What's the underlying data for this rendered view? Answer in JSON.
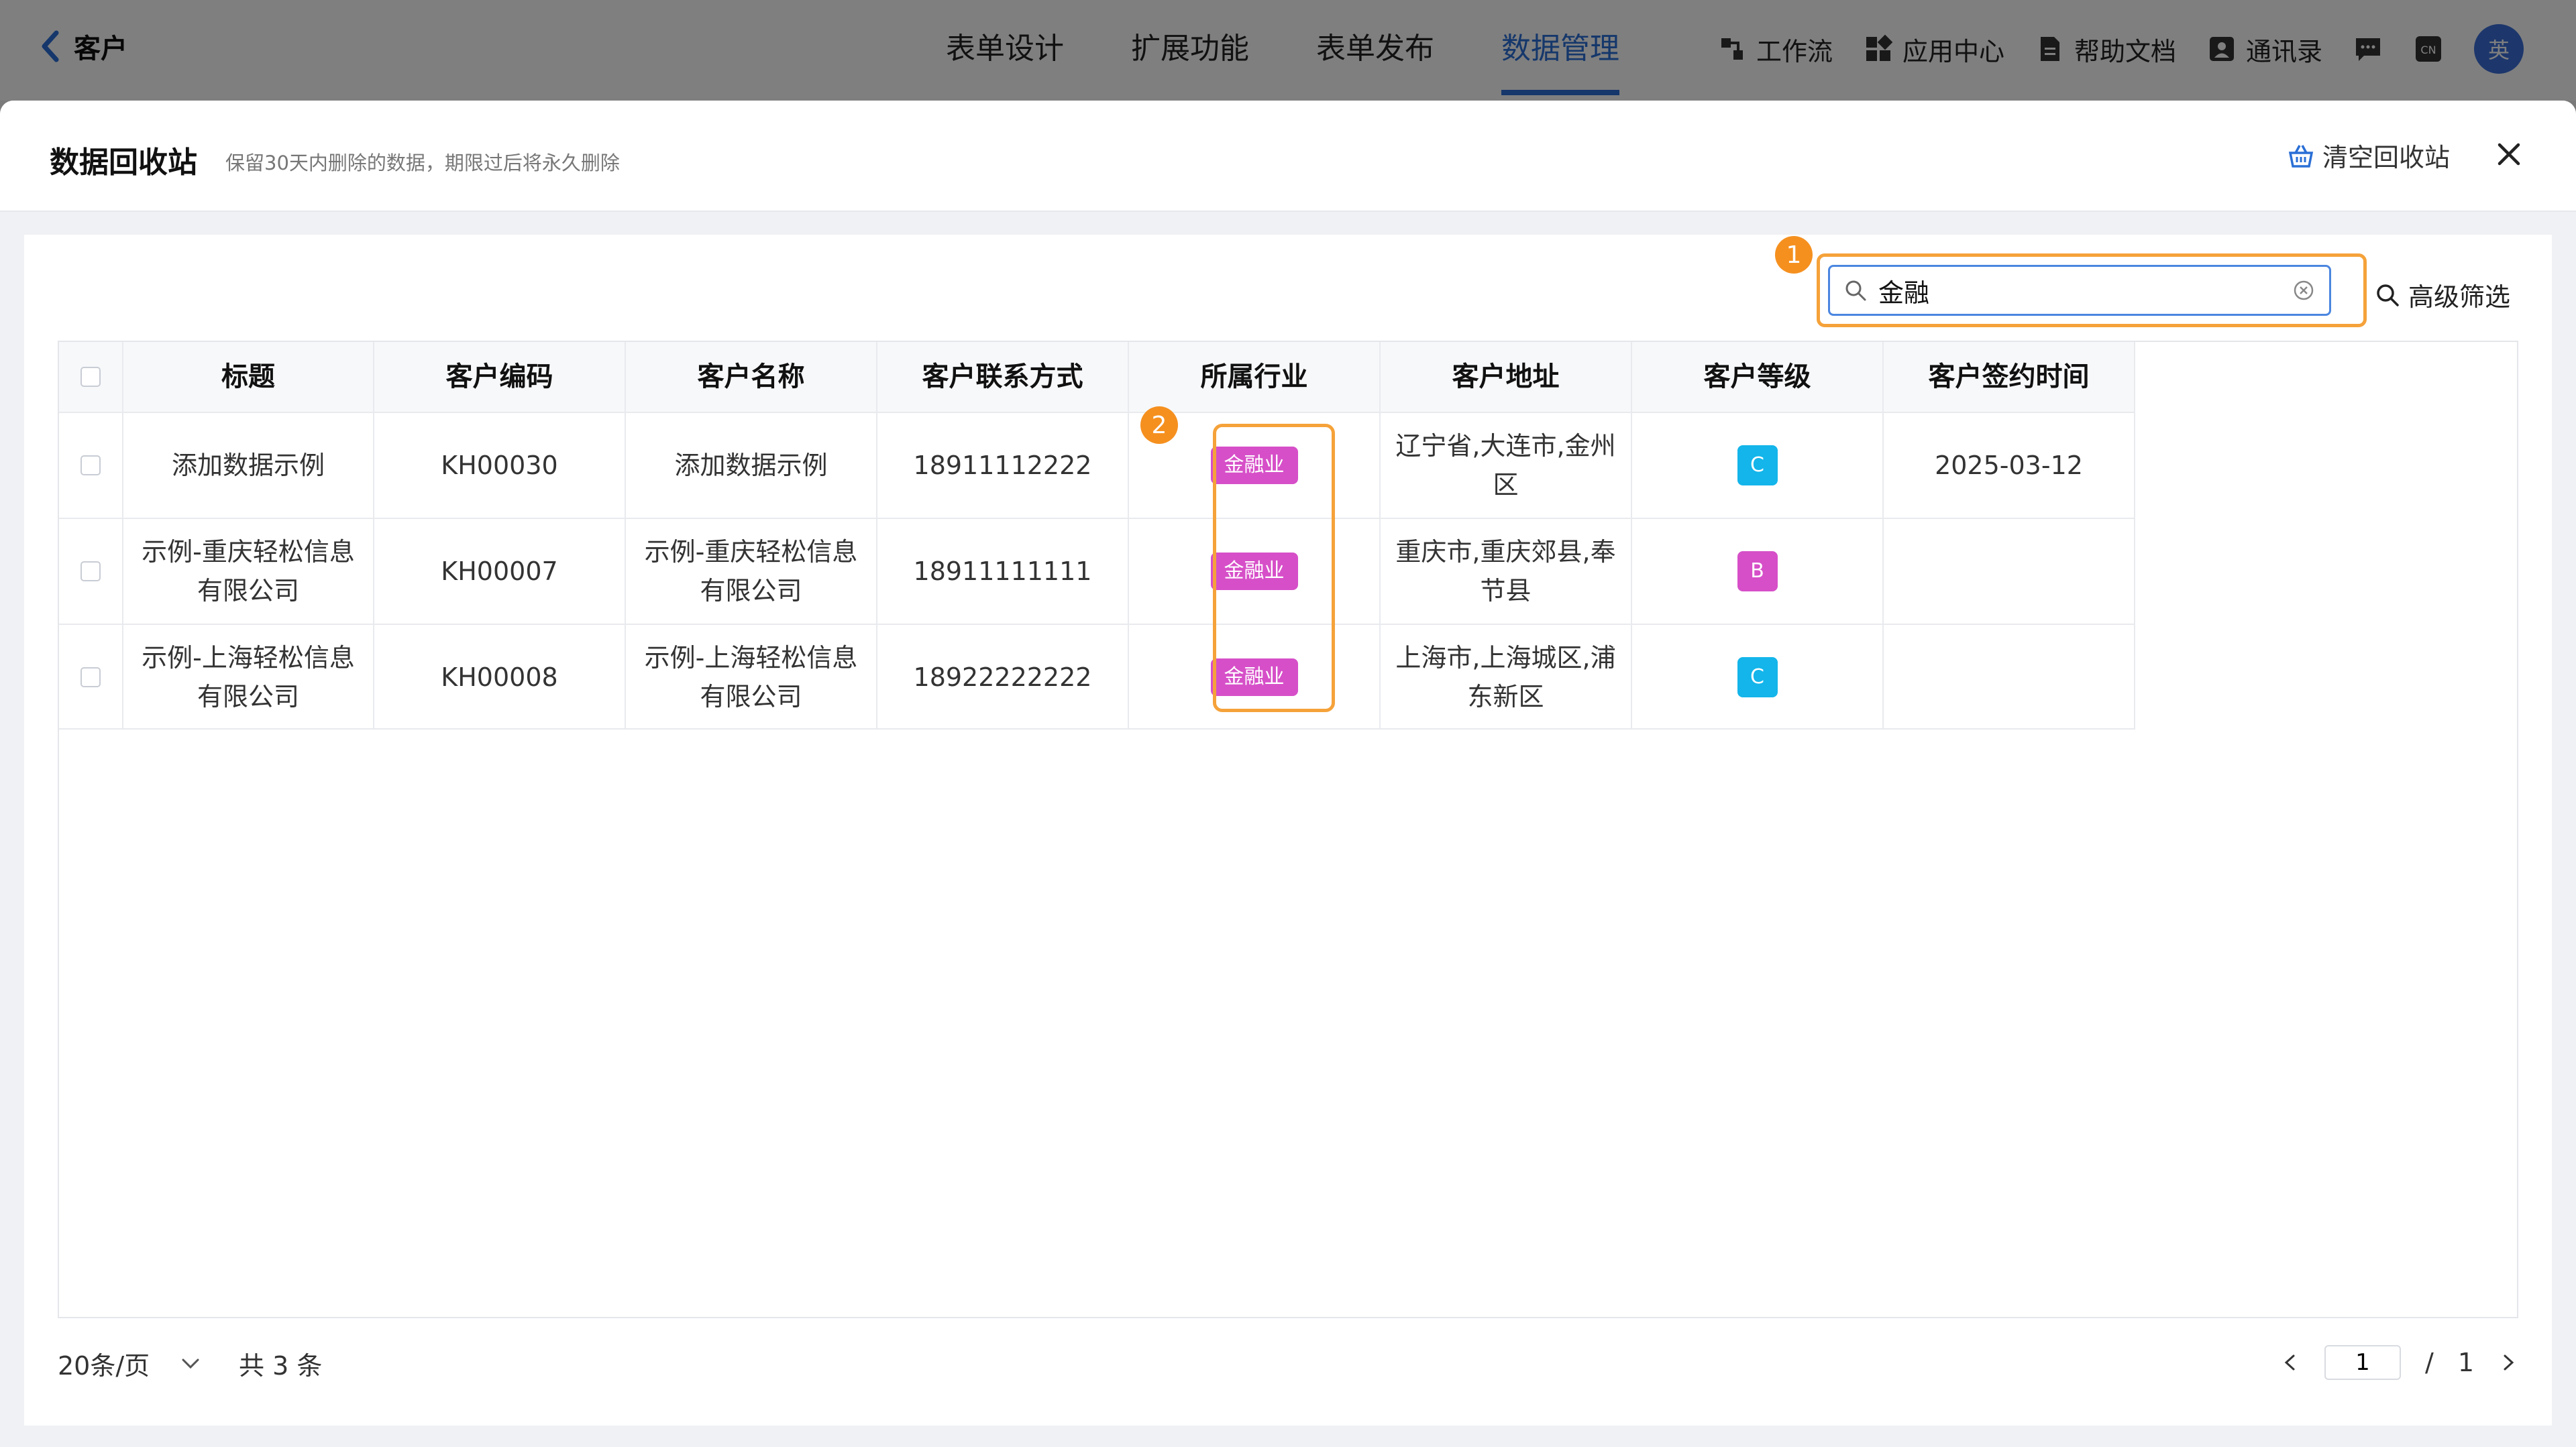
{
  "app": {
    "back_label": "客户"
  },
  "nav": {
    "items": [
      "表单设计",
      "扩展功能",
      "表单发布",
      "数据管理"
    ],
    "active_index": 3
  },
  "tools": {
    "workflow": "工作流",
    "app_center": "应用中心",
    "help_docs": "帮助文档",
    "contacts": "通讯录",
    "lang": "CN",
    "avatar_text": "英"
  },
  "panel": {
    "title": "数据回收站",
    "subtitle": "保留30天内删除的数据，期限过后将永久删除",
    "clear_label": "清空回收站"
  },
  "search": {
    "value": "金融",
    "badge": "1"
  },
  "advanced_filter": "高级筛选",
  "highlight_badge": "2",
  "table": {
    "headers": [
      "标题",
      "客户编码",
      "客户名称",
      "客户联系方式",
      "所属行业",
      "客户地址",
      "客户等级",
      "客户签约时间"
    ],
    "rows": [
      {
        "title": "添加数据示例",
        "code": "KH00030",
        "name": "添加数据示例",
        "phone": "18911112222",
        "industry": "金融业",
        "address": "辽宁省,大连市,金州区",
        "level": "C",
        "sign_date": "2025-03-12"
      },
      {
        "title": "示例-重庆轻松信息有限公司",
        "code": "KH00007",
        "name": "示例-重庆轻松信息有限公司",
        "phone": "18911111111",
        "industry": "金融业",
        "address": "重庆市,重庆郊县,奉节县",
        "level": "B",
        "sign_date": ""
      },
      {
        "title": "示例-上海轻松信息有限公司",
        "code": "KH00008",
        "name": "示例-上海轻松信息有限公司",
        "phone": "18922222222",
        "industry": "金融业",
        "address": "上海市,上海城区,浦东新区",
        "level": "C",
        "sign_date": ""
      }
    ]
  },
  "pagination": {
    "page_size": "20条/页",
    "total": "共 3 条",
    "current_page": "1",
    "separator": "/",
    "total_pages": "1"
  },
  "colors": {
    "accent": "#2a6fd6",
    "highlight": "#f5a23a",
    "industry_tag": "#d64fc8",
    "level_C": "#13b5ea",
    "level_B": "#d64fc8"
  }
}
